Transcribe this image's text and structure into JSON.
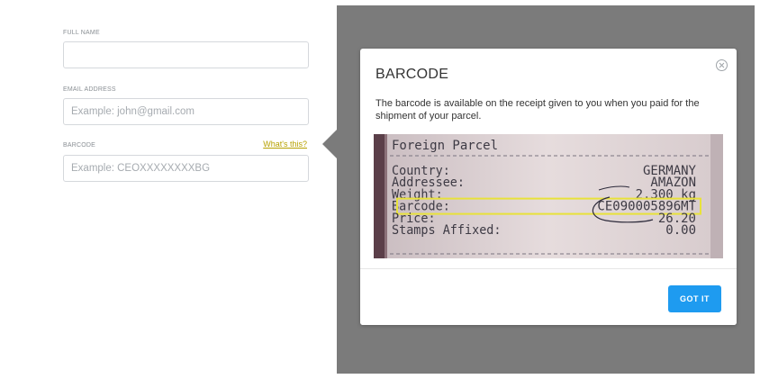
{
  "form": {
    "full_name": {
      "label": "FULL NAME",
      "value": "",
      "placeholder": ""
    },
    "email": {
      "label": "EMAIL ADDRESS",
      "value": "",
      "placeholder": "Example: john@gmail.com"
    },
    "barcode": {
      "label": "BARCODE",
      "value": "",
      "placeholder": "Example: CEOXXXXXXXXBG",
      "help_link": "What's this?"
    }
  },
  "modal": {
    "title": "BARCODE",
    "description": "The barcode is available on the receipt given to you when you paid for the shipment of your parcel.",
    "receipt": {
      "heading": "Foreign Parcel",
      "rows": [
        {
          "label": "Country:",
          "value": "GERMANY"
        },
        {
          "label": "Addressee:",
          "value": "AMAZON"
        },
        {
          "label": "Weight:",
          "value": "2.300 kg"
        },
        {
          "label": "Barcode:",
          "value": "CE090005896MT"
        },
        {
          "label": "Price:",
          "value": "26.20"
        },
        {
          "label": "Stamps Affixed:",
          "value": "0.00"
        }
      ],
      "highlight_color": "#e8e23a"
    },
    "confirm_label": "GOT IT"
  },
  "colors": {
    "accent": "#1e9bf0",
    "link": "#b7a100",
    "overlay": "#7b7b7b"
  }
}
